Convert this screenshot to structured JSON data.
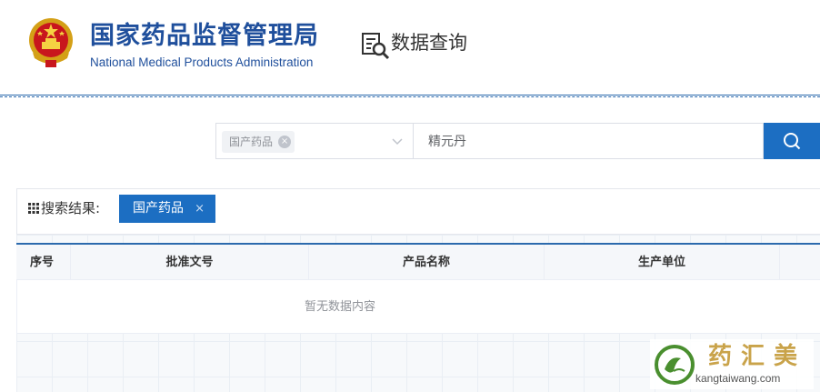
{
  "header": {
    "org_name_cn": "国家药品监督管理局",
    "org_name_en": "National Medical Products Administration",
    "query_title": "数据查询",
    "icons": [
      "national-emblem-icon",
      "data-query-icon"
    ]
  },
  "search": {
    "category_tag": "国产药品",
    "category_tag_close": "×",
    "keyword_value": "精元丹",
    "icons": [
      "chevron-down-icon",
      "search-icon"
    ]
  },
  "results": {
    "label": "搜索结果:",
    "active_filter": "国产药品",
    "active_filter_close": "×",
    "icon": "grid-icon"
  },
  "table": {
    "columns": [
      "序号",
      "批准文号",
      "产品名称",
      "生产单位",
      ""
    ],
    "empty_text": "暂无数据内容"
  },
  "watermark": {
    "brand_cn": "药汇美",
    "brand_en": "kangtaiwang.com"
  },
  "colors": {
    "primary": "#1c6ec2",
    "org_blue": "#1f4f9c",
    "brand_gold": "#c9a34a",
    "brand_green": "#4a8f2f"
  }
}
